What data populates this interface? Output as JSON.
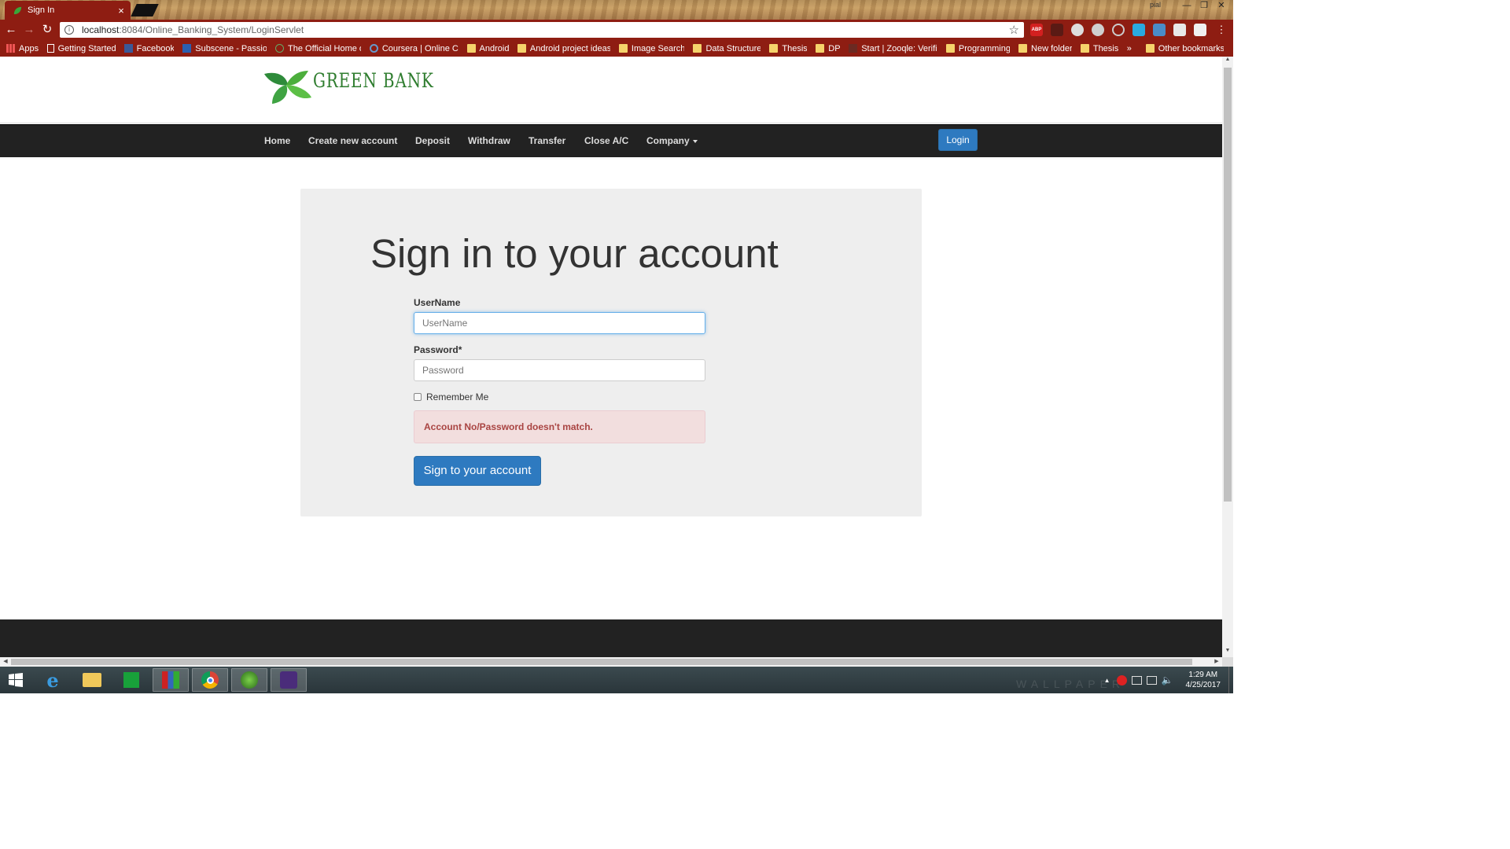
{
  "browser": {
    "tab_title": "Sign In",
    "tab_close": "×",
    "profile_name": "pial",
    "url_host": "localhost",
    "url_path": ":8084/Online_Banking_System/LoginServlet",
    "bookmarks": [
      {
        "label": "Apps",
        "icon": "apps-grid-icon"
      },
      {
        "label": "Getting Started",
        "icon": "page-icon"
      },
      {
        "label": "Facebook",
        "icon": "facebook-icon"
      },
      {
        "label": "Subscene - Passionat",
        "icon": "subscene-icon"
      },
      {
        "label": "The Official Home of \\",
        "icon": "site-icon"
      },
      {
        "label": "Coursera | Online Cou",
        "icon": "coursera-icon"
      },
      {
        "label": "Android",
        "icon": "folder-icon"
      },
      {
        "label": "Android project ideas",
        "icon": "folder-icon"
      },
      {
        "label": "Image Search",
        "icon": "folder-icon"
      },
      {
        "label": "Data Structure",
        "icon": "folder-icon"
      },
      {
        "label": "Thesis",
        "icon": "folder-icon"
      },
      {
        "label": "DP",
        "icon": "folder-icon"
      },
      {
        "label": "Start | Zooqle: Verifiec",
        "icon": "site-icon"
      },
      {
        "label": "Programming",
        "icon": "folder-icon"
      },
      {
        "label": "New folder",
        "icon": "folder-icon"
      },
      {
        "label": "Thesis",
        "icon": "folder-icon"
      }
    ],
    "overflow": "»",
    "other_bookmarks": "Other bookmarks"
  },
  "site": {
    "brand": "GREEN BANK",
    "nav": [
      "Home",
      "Create new account",
      "Deposit",
      "Withdraw",
      "Transfer",
      "Close A/C",
      "Company"
    ],
    "login_label": "Login"
  },
  "form": {
    "title": "Sign in to your account",
    "username_label": "UserName",
    "username_placeholder": "UserName",
    "password_label": "Password*",
    "password_placeholder": "Password",
    "remember_label": "Remember Me",
    "error_message": "Account No/Password doesn't match.",
    "submit_label": "Sign to your account"
  },
  "taskbar": {
    "time": "1:29 AM",
    "date": "4/25/2017",
    "wallpaper_watermark": "WALLPAPER"
  },
  "colors": {
    "chrome_accent": "#8e1d12",
    "primary_button": "#2e7ac0",
    "error_bg": "#f2dede",
    "error_text": "#a94442"
  }
}
